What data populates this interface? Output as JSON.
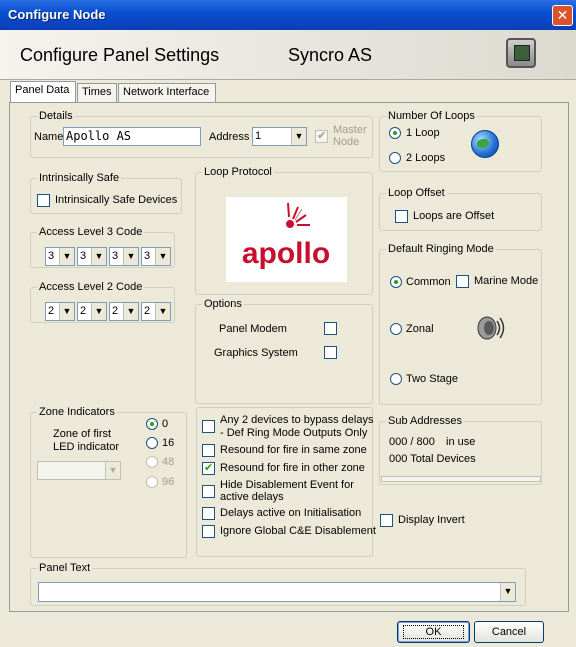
{
  "window": {
    "title": "Configure Node",
    "close_label": "✕"
  },
  "header": {
    "title": "Configure Panel Settings",
    "panel_name": "Syncro AS",
    "icon": "panel-icon"
  },
  "tabs": [
    "Panel Data",
    "Times",
    "Network Interface"
  ],
  "details": {
    "legend": "Details",
    "name_label": "Name",
    "name_value": "Apollo AS",
    "address_label": "Address",
    "address_value": "1",
    "master_node_label": "Master Node",
    "master_node_checked": true
  },
  "intrinsically_safe": {
    "legend": "Intrinsically Safe",
    "devices_label": "Intrinsically Safe Devices",
    "checked": false
  },
  "access_level_3": {
    "legend": "Access Level 3 Code",
    "digits": [
      "3",
      "3",
      "3",
      "3"
    ]
  },
  "access_level_2": {
    "legend": "Access Level 2 Code",
    "digits": [
      "2",
      "2",
      "2",
      "2"
    ]
  },
  "loop_protocol": {
    "legend": "Loop Protocol",
    "logo_text": "apollo"
  },
  "options": {
    "legend": "Options",
    "panel_modem_label": "Panel Modem",
    "graphics_system_label": "Graphics System"
  },
  "number_of_loops": {
    "legend": "Number Of Loops",
    "options": [
      "1 Loop",
      "2 Loops"
    ],
    "selected": "1 Loop"
  },
  "loop_offset": {
    "legend": "Loop Offset",
    "label": "Loops are Offset"
  },
  "ringing_mode": {
    "legend": "Default Ringing Mode",
    "common_label": "Common",
    "marine_label": "Marine Mode",
    "zonal_label": "Zonal",
    "two_stage_label": "Two Stage",
    "selected": "Common"
  },
  "zone_indicators": {
    "legend": "Zone Indicators",
    "desc_line1": "Zone of first",
    "desc_line2": "LED indicator",
    "options": [
      "0",
      "16",
      "48",
      "96"
    ],
    "selected": "0"
  },
  "checks": {
    "bypass_line1": "Any 2 devices to bypass delays",
    "bypass_line2": "- Def Ring Mode Outputs Only",
    "resound_same": "Resound for fire in same zone",
    "resound_other": "Resound for fire in other zone",
    "hide_line1": "Hide Disablement Event for",
    "hide_line2": "active delays",
    "delays_init": "Delays active on Initialisation",
    "ignore_global": "Ignore Global C&E Disablement"
  },
  "sub_addresses": {
    "legend": "Sub Addresses",
    "usage": "000 / 800",
    "in_use": "in use",
    "total": "000 Total Devices"
  },
  "display_invert": {
    "label": "Display Invert"
  },
  "panel_text": {
    "legend": "Panel Text",
    "value": ""
  },
  "buttons": {
    "ok": "OK",
    "cancel": "Cancel"
  },
  "colors": {
    "titlebar": "#0a4fd1",
    "apollo_red": "#c8102e",
    "check_green": "#21a121"
  }
}
